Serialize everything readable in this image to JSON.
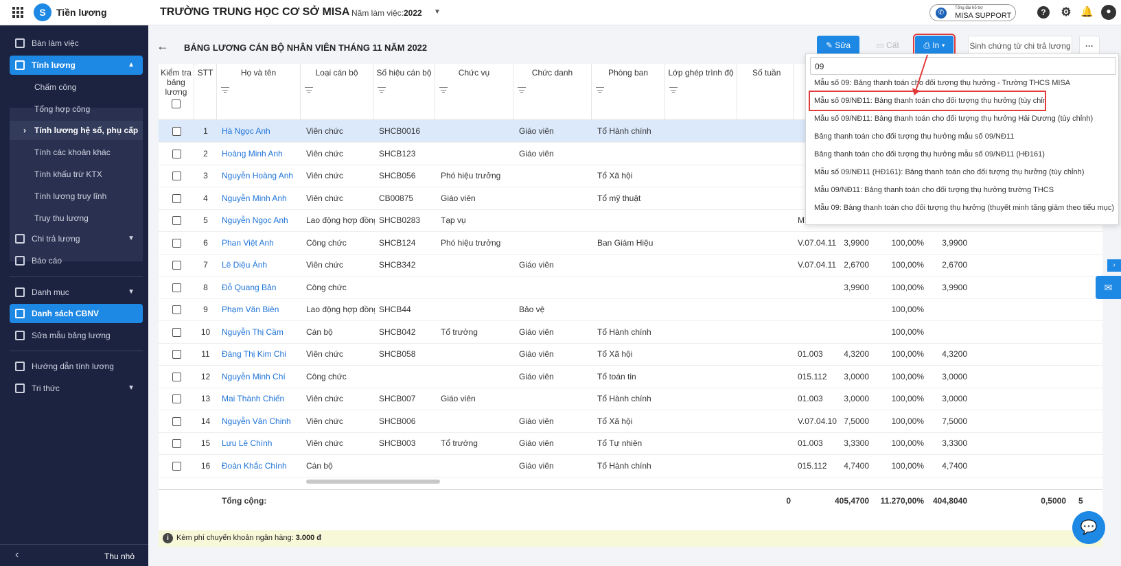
{
  "app": {
    "name": "Tiền lương",
    "school": "TRƯỜNG TRUNG HỌC CƠ SỞ MISA",
    "year_label": "Năm làm việc:",
    "year_value": "2022"
  },
  "support": {
    "line1": "Tổng đài hỗ trợ",
    "line2": "MISA SUPPORT"
  },
  "sidebar": {
    "items": [
      {
        "label": "Bàn làm việc"
      },
      {
        "label": "Tính lương"
      },
      {
        "label": "Chi trả lương"
      },
      {
        "label": "Báo cáo"
      },
      {
        "label": "Danh mục"
      },
      {
        "label": "Danh sách CBNV"
      },
      {
        "label": "Sửa mẫu bảng lương"
      },
      {
        "label": "Hướng dẫn tính lương"
      },
      {
        "label": "Tri thức"
      }
    ],
    "sub_items": [
      {
        "label": "Chấm công"
      },
      {
        "label": "Tổng hợp công"
      },
      {
        "label": "Tính lương hệ số, phụ cấp"
      },
      {
        "label": "Tính các khoản khác"
      },
      {
        "label": "Tính khấu trừ KTX"
      },
      {
        "label": "Tính lương truy lĩnh"
      },
      {
        "label": "Truy thu lương"
      }
    ],
    "collapse_label": "Thu nhỏ"
  },
  "page": {
    "title": "BẢNG LƯƠNG CÁN BỘ NHÂN VIÊN THÁNG 11 NĂM 2022"
  },
  "toolbar": {
    "edit": "Sửa",
    "cut": "Cất",
    "print": "In",
    "voucher": "Sinh chứng từ chi trả lương",
    "more": "···"
  },
  "table": {
    "headers": [
      "Kiểm tra bảng lương",
      "STT",
      "Họ và tên",
      "Loại cán bộ",
      "Số hiệu cán bộ",
      "Chức vụ",
      "Chức danh",
      "Phòng ban",
      "Lớp ghép trình độ",
      "Số tuần"
    ],
    "rows": [
      {
        "stt": "1",
        "name": "Hà Ngọc Anh",
        "type": "Viên chức",
        "code": "SHCB0016",
        "pos": "",
        "title": "Giáo viên",
        "dept": "Tổ Hành chính",
        "grade": "",
        "c1": "",
        "c2": "",
        "c3": "",
        "hl": true
      },
      {
        "stt": "2",
        "name": "Hoàng Minh Anh",
        "type": "Viên chức",
        "code": "SHCB123",
        "pos": "",
        "title": "Giáo viên",
        "dept": "",
        "grade": "",
        "c1": "",
        "c2": "",
        "c3": ""
      },
      {
        "stt": "3",
        "name": "Nguyễn Hoàng Anh",
        "type": "Viên chức",
        "code": "SHCB056",
        "pos": "Phó hiệu trưởng",
        "title": "",
        "dept": "Tổ Xã hội",
        "grade": "",
        "c1": "",
        "c2": "",
        "c3": ""
      },
      {
        "stt": "4",
        "name": "Nguyễn Minh Anh",
        "type": "Viên chức",
        "code": "CB00875",
        "pos": "Giáo viên",
        "title": "",
        "dept": "Tổ mỹ thuật",
        "grade": "",
        "c1": "",
        "c2": "",
        "c3": ""
      },
      {
        "stt": "5",
        "name": "Nguyễn Ngọc Anh",
        "type": "Lao động hợp đồng",
        "code": "SHCB0283",
        "pos": "Tạp vụ",
        "title": "",
        "dept": "",
        "grade": "MT.1",
        "c1": "",
        "c2": "100,00%",
        "c3": ""
      },
      {
        "stt": "6",
        "name": "Phan Việt Anh",
        "type": "Công chức",
        "code": "SHCB124",
        "pos": "Phó hiệu trưởng",
        "title": "",
        "dept": "Ban Giám Hiệu",
        "grade": "V.07.04.11",
        "c1": "3,9900",
        "c2": "100,00%",
        "c3": "3,9900"
      },
      {
        "stt": "7",
        "name": "Lê Diệu Ánh",
        "type": "Viên chức",
        "code": "SHCB342",
        "pos": "",
        "title": "Giáo viên",
        "dept": "",
        "grade": "V.07.04.11",
        "c1": "2,6700",
        "c2": "100,00%",
        "c3": "2,6700"
      },
      {
        "stt": "8",
        "name": "Đỗ Quang Bản",
        "type": "Công chức",
        "code": "",
        "pos": "",
        "title": "",
        "dept": "",
        "grade": "",
        "c1": "3,9900",
        "c2": "100,00%",
        "c3": "3,9900"
      },
      {
        "stt": "9",
        "name": "Phạm Văn Biên",
        "type": "Lao động hợp đồng",
        "code": "SHCB44",
        "pos": "",
        "title": "Bảo vệ",
        "dept": "",
        "grade": "",
        "c1": "",
        "c2": "100,00%",
        "c3": ""
      },
      {
        "stt": "10",
        "name": "Nguyễn Thị Cầm",
        "type": "Cán bộ",
        "code": "SHCB042",
        "pos": "Tổ trưởng",
        "title": "Giáo viên",
        "dept": "Tổ Hành chính",
        "grade": "",
        "c1": "",
        "c2": "100,00%",
        "c3": ""
      },
      {
        "stt": "11",
        "name": "Đàng Thị Kim Chi",
        "type": "Viên chức",
        "code": "SHCB058",
        "pos": "",
        "title": "Giáo viên",
        "dept": "Tổ Xã hội",
        "grade": "01.003",
        "c1": "4,3200",
        "c2": "100,00%",
        "c3": "4,3200"
      },
      {
        "stt": "12",
        "name": "Nguyễn Minh Chí",
        "type": "Công chức",
        "code": "",
        "pos": "",
        "title": "Giáo viên",
        "dept": "Tổ toán tin",
        "grade": "015.112",
        "c1": "3,0000",
        "c2": "100,00%",
        "c3": "3,0000"
      },
      {
        "stt": "13",
        "name": "Mai Thành Chiến",
        "type": "Viên chức",
        "code": "SHCB007",
        "pos": "Giáo viên",
        "title": "",
        "dept": "Tổ Hành chính",
        "grade": "01.003",
        "c1": "3,0000",
        "c2": "100,00%",
        "c3": "3,0000"
      },
      {
        "stt": "14",
        "name": "Nguyễn Văn Chinh",
        "type": "Viên chức",
        "code": "SHCB006",
        "pos": "",
        "title": "Giáo viên",
        "dept": "Tổ Xã hội",
        "grade": "V.07.04.10",
        "c1": "7,5000",
        "c2": "100,00%",
        "c3": "7,5000"
      },
      {
        "stt": "15",
        "name": "Lưu Lê Chính",
        "type": "Viên chức",
        "code": "SHCB003",
        "pos": "Tổ trưởng",
        "title": "Giáo viên",
        "dept": "Tổ Tự nhiên",
        "grade": "01.003",
        "c1": "3,3300",
        "c2": "100,00%",
        "c3": "3,3300"
      },
      {
        "stt": "16",
        "name": "Đoàn Khắc Chính",
        "type": "Cán bộ",
        "code": "",
        "pos": "",
        "title": "Giáo viên",
        "dept": "Tổ Hành chính",
        "grade": "015.112",
        "c1": "4,7400",
        "c2": "100,00%",
        "c3": "4,7400"
      }
    ],
    "total": {
      "label": "Tổng cộng:",
      "weeks": "0",
      "c1": "405,4700",
      "c2": "11.270,00%",
      "c3": "404,8040",
      "c4": "0,5000",
      "c5": "5"
    }
  },
  "footnote": {
    "text": "Kèm phí chuyển khoản ngân hàng:",
    "value": "3.000 đ"
  },
  "dropdown": {
    "search": "09",
    "options": [
      "Mẫu số 09: Bảng thanh toán cho đối tượng thụ hưởng - Trường THCS MISA",
      "Mẫu số 09/NĐ11: Bảng thanh toán cho đối tượng thụ hưởng (tùy chỉnh)",
      "Mẫu số 09/NĐ11: Bảng thanh toán cho đối tượng thụ hưởng Hải Dương (tùy chỉnh)",
      "Bảng thanh toán cho đối tượng thụ hưởng mẫu số 09/NĐ11",
      "Bảng thanh toán cho đối tượng thụ hưởng mẫu số 09/NĐ11 (HĐ161)",
      "Mẫu số 09/NĐ11 (HĐ161): Bảng thanh toán cho đối tượng thụ hưởng (tùy chỉnh)",
      "Mẫu 09/NĐ11: Bảng thanh toán cho đối tượng thụ hưởng trường THCS",
      "Mẫu 09: Bảng thanh toán cho đối tượng thụ hưởng (thuyết minh tăng giảm theo tiểu mục)"
    ]
  }
}
